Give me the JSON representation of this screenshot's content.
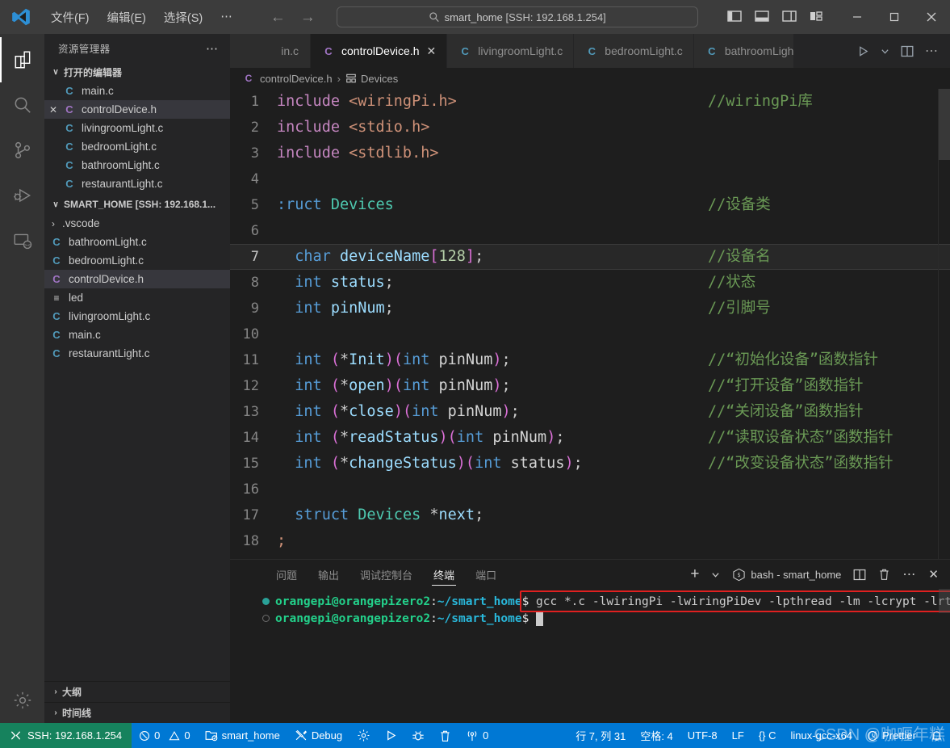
{
  "titlebar": {
    "logo": "vscode-logo",
    "menus": [
      "文件(F)",
      "编辑(E)",
      "选择(S)",
      "⋯"
    ],
    "nav_back": "←",
    "nav_forward": "→",
    "command_center": {
      "icon": "search-icon",
      "project": "smart_home ",
      "ssh": "[SSH: 192.168.1.254]"
    },
    "layout_icons": [
      "toggle-primary-sidebar-icon",
      "toggle-panel-icon",
      "toggle-secondary-sidebar-icon",
      "customize-layout-icon"
    ],
    "window_controls": {
      "minimize": "–",
      "maximize": "□",
      "close": "✕"
    }
  },
  "activitybar": {
    "items": [
      {
        "name": "explorer",
        "icon": "files-icon",
        "active": true
      },
      {
        "name": "search",
        "icon": "search-icon",
        "active": false
      },
      {
        "name": "source-control",
        "icon": "source-control-icon",
        "active": false
      },
      {
        "name": "run-debug",
        "icon": "run-and-debug-icon",
        "active": false
      },
      {
        "name": "remote-explorer",
        "icon": "remote-explorer-icon",
        "active": false
      }
    ],
    "manage": {
      "name": "settings",
      "icon": "gear-icon"
    }
  },
  "sidebar": {
    "title": "资源管理器",
    "more": "⋯",
    "open_editors": {
      "label": "打开的编辑器",
      "chevron": "∨",
      "items": [
        {
          "name": "main.c",
          "icon": "c-file-icon",
          "selected": false,
          "closable": false
        },
        {
          "name": "controlDevice.h",
          "icon": "h-file-icon",
          "selected": true,
          "closable": true
        },
        {
          "name": "livingroomLight.c",
          "icon": "c-file-icon",
          "selected": false,
          "closable": false
        },
        {
          "name": "bedroomLight.c",
          "icon": "c-file-icon",
          "selected": false,
          "closable": false
        },
        {
          "name": "bathroomLight.c",
          "icon": "c-file-icon",
          "selected": false,
          "closable": false
        },
        {
          "name": "restaurantLight.c",
          "icon": "c-file-icon",
          "selected": false,
          "closable": false
        }
      ]
    },
    "workspace": {
      "label": "SMART_HOME [SSH: 192.168.1...",
      "chevron": "∨",
      "items": [
        {
          "name": ".vscode",
          "icon": "folder-chevron",
          "kind": "folder",
          "selected": false
        },
        {
          "name": "bathroomLight.c",
          "icon": "c-file-icon",
          "kind": "c",
          "selected": false
        },
        {
          "name": "bedroomLight.c",
          "icon": "c-file-icon",
          "kind": "c",
          "selected": false
        },
        {
          "name": "controlDevice.h",
          "icon": "h-file-icon",
          "kind": "h",
          "selected": true
        },
        {
          "name": "led",
          "icon": "binary-file-icon",
          "kind": "bin",
          "selected": false
        },
        {
          "name": "livingroomLight.c",
          "icon": "c-file-icon",
          "kind": "c",
          "selected": false
        },
        {
          "name": "main.c",
          "icon": "c-file-icon",
          "kind": "c",
          "selected": false
        },
        {
          "name": "restaurantLight.c",
          "icon": "c-file-icon",
          "kind": "c",
          "selected": false
        }
      ]
    },
    "bottom_sections": [
      {
        "label": "大纲",
        "chevron": "›"
      },
      {
        "label": "时间线",
        "chevron": "›"
      }
    ]
  },
  "tabs": {
    "items": [
      {
        "label": "in.c",
        "icon": "c-file-icon",
        "active": false,
        "closable": false,
        "clipped": true
      },
      {
        "label": "controlDevice.h",
        "icon": "h-file-icon",
        "active": true,
        "closable": true
      },
      {
        "label": "livingroomLight.c",
        "icon": "c-file-icon",
        "active": false,
        "closable": false
      },
      {
        "label": "bedroomLight.c",
        "icon": "c-file-icon",
        "active": false,
        "closable": false
      },
      {
        "label": "bathroomLigh",
        "icon": "c-file-icon",
        "active": false,
        "closable": false,
        "clipped": true
      }
    ],
    "actions": [
      "run-icon",
      "chevron-down-icon",
      "split-editor-icon",
      "more-actions-icon"
    ]
  },
  "breadcrumb": {
    "file": "controlDevice.h",
    "separator": "›",
    "symbol": "Devices"
  },
  "editor": {
    "current_line": 7,
    "lines": [
      {
        "n": 1,
        "tokens": [
          {
            "t": "pre",
            "v": "include"
          },
          {
            "t": "plain",
            "v": " "
          },
          {
            "t": "str",
            "v": "<wiringPi.h>"
          }
        ],
        "comment": "//wiringPi库"
      },
      {
        "n": 2,
        "tokens": [
          {
            "t": "pre",
            "v": "include"
          },
          {
            "t": "plain",
            "v": " "
          },
          {
            "t": "str",
            "v": "<stdio.h>"
          }
        ],
        "comment": ""
      },
      {
        "n": 3,
        "tokens": [
          {
            "t": "pre",
            "v": "include"
          },
          {
            "t": "plain",
            "v": " "
          },
          {
            "t": "str",
            "v": "<stdlib.h>"
          }
        ],
        "comment": ""
      },
      {
        "n": 4,
        "tokens": [],
        "comment": ""
      },
      {
        "n": 5,
        "tokens": [
          {
            "t": "kw",
            "v": ":ruct"
          },
          {
            "t": "plain",
            "v": " "
          },
          {
            "t": "type",
            "v": "Devices"
          }
        ],
        "comment": "//设备类"
      },
      {
        "n": 6,
        "tokens": [],
        "comment": ""
      },
      {
        "n": 7,
        "tokens": [
          {
            "t": "plain",
            "v": "  "
          },
          {
            "t": "kw",
            "v": "char"
          },
          {
            "t": "plain",
            "v": " "
          },
          {
            "t": "var",
            "v": "deviceName"
          },
          {
            "t": "brk",
            "v": "["
          },
          {
            "t": "num",
            "v": "128"
          },
          {
            "t": "brk",
            "v": "]"
          },
          {
            "t": "punc",
            "v": ";"
          }
        ],
        "comment": "//设备名"
      },
      {
        "n": 8,
        "tokens": [
          {
            "t": "plain",
            "v": "  "
          },
          {
            "t": "kw",
            "v": "int"
          },
          {
            "t": "plain",
            "v": " "
          },
          {
            "t": "var",
            "v": "status"
          },
          {
            "t": "punc",
            "v": ";"
          }
        ],
        "comment": "//状态"
      },
      {
        "n": 9,
        "tokens": [
          {
            "t": "plain",
            "v": "  "
          },
          {
            "t": "kw",
            "v": "int"
          },
          {
            "t": "plain",
            "v": " "
          },
          {
            "t": "var",
            "v": "pinNum"
          },
          {
            "t": "punc",
            "v": ";"
          }
        ],
        "comment": "//引脚号"
      },
      {
        "n": 10,
        "tokens": [],
        "comment": ""
      },
      {
        "n": 11,
        "tokens": [
          {
            "t": "plain",
            "v": "  "
          },
          {
            "t": "kw",
            "v": "int"
          },
          {
            "t": "plain",
            "v": " "
          },
          {
            "t": "brk",
            "v": "("
          },
          {
            "t": "punc",
            "v": "*"
          },
          {
            "t": "var",
            "v": "Init"
          },
          {
            "t": "brk",
            "v": ")"
          },
          {
            "t": "brk",
            "v": "("
          },
          {
            "t": "kw",
            "v": "int"
          },
          {
            "t": "plain",
            "v": " "
          },
          {
            "t": "plain",
            "v": "pinNum"
          },
          {
            "t": "brk",
            "v": ")"
          },
          {
            "t": "punc",
            "v": ";"
          }
        ],
        "comment": "//“初始化设备”函数指针"
      },
      {
        "n": 12,
        "tokens": [
          {
            "t": "plain",
            "v": "  "
          },
          {
            "t": "kw",
            "v": "int"
          },
          {
            "t": "plain",
            "v": " "
          },
          {
            "t": "brk",
            "v": "("
          },
          {
            "t": "punc",
            "v": "*"
          },
          {
            "t": "var",
            "v": "open"
          },
          {
            "t": "brk",
            "v": ")"
          },
          {
            "t": "brk",
            "v": "("
          },
          {
            "t": "kw",
            "v": "int"
          },
          {
            "t": "plain",
            "v": " "
          },
          {
            "t": "plain",
            "v": "pinNum"
          },
          {
            "t": "brk",
            "v": ")"
          },
          {
            "t": "punc",
            "v": ";"
          }
        ],
        "comment": "//“打开设备”函数指针"
      },
      {
        "n": 13,
        "tokens": [
          {
            "t": "plain",
            "v": "  "
          },
          {
            "t": "kw",
            "v": "int"
          },
          {
            "t": "plain",
            "v": " "
          },
          {
            "t": "brk",
            "v": "("
          },
          {
            "t": "punc",
            "v": "*"
          },
          {
            "t": "var",
            "v": "close"
          },
          {
            "t": "brk",
            "v": ")"
          },
          {
            "t": "brk",
            "v": "("
          },
          {
            "t": "kw",
            "v": "int"
          },
          {
            "t": "plain",
            "v": " "
          },
          {
            "t": "plain",
            "v": "pinNum"
          },
          {
            "t": "brk",
            "v": ")"
          },
          {
            "t": "punc",
            "v": ";"
          }
        ],
        "comment": "//“关闭设备”函数指针"
      },
      {
        "n": 14,
        "tokens": [
          {
            "t": "plain",
            "v": "  "
          },
          {
            "t": "kw",
            "v": "int"
          },
          {
            "t": "plain",
            "v": " "
          },
          {
            "t": "brk",
            "v": "("
          },
          {
            "t": "punc",
            "v": "*"
          },
          {
            "t": "var",
            "v": "readStatus"
          },
          {
            "t": "brk",
            "v": ")"
          },
          {
            "t": "brk",
            "v": "("
          },
          {
            "t": "kw",
            "v": "int"
          },
          {
            "t": "plain",
            "v": " "
          },
          {
            "t": "plain",
            "v": "pinNum"
          },
          {
            "t": "brk",
            "v": ")"
          },
          {
            "t": "punc",
            "v": ";"
          }
        ],
        "comment": "//“读取设备状态”函数指针"
      },
      {
        "n": 15,
        "tokens": [
          {
            "t": "plain",
            "v": "  "
          },
          {
            "t": "kw",
            "v": "int"
          },
          {
            "t": "plain",
            "v": " "
          },
          {
            "t": "brk",
            "v": "("
          },
          {
            "t": "punc",
            "v": "*"
          },
          {
            "t": "var",
            "v": "changeStatus"
          },
          {
            "t": "brk",
            "v": ")"
          },
          {
            "t": "brk",
            "v": "("
          },
          {
            "t": "kw",
            "v": "int"
          },
          {
            "t": "plain",
            "v": " "
          },
          {
            "t": "plain",
            "v": "status"
          },
          {
            "t": "brk",
            "v": ")"
          },
          {
            "t": "punc",
            "v": ";"
          }
        ],
        "comment": "//“改变设备状态”函数指针"
      },
      {
        "n": 16,
        "tokens": [],
        "comment": ""
      },
      {
        "n": 17,
        "tokens": [
          {
            "t": "plain",
            "v": "  "
          },
          {
            "t": "kw",
            "v": "struct"
          },
          {
            "t": "plain",
            "v": " "
          },
          {
            "t": "type",
            "v": "Devices"
          },
          {
            "t": "plain",
            "v": " "
          },
          {
            "t": "punc",
            "v": "*"
          },
          {
            "t": "var",
            "v": "next"
          },
          {
            "t": "punc",
            "v": ";"
          }
        ],
        "comment": ""
      },
      {
        "n": 18,
        "tokens": [
          {
            "t": "str",
            "v": ";"
          }
        ],
        "comment": ""
      }
    ]
  },
  "panel": {
    "tabs": [
      {
        "label": "问题",
        "active": false
      },
      {
        "label": "输出",
        "active": false
      },
      {
        "label": "调试控制台",
        "active": false
      },
      {
        "label": "终端",
        "active": true
      },
      {
        "label": "端口",
        "active": false
      }
    ],
    "actions": {
      "new_terminal": "+",
      "dropdown": "∨",
      "shell_icon": "terminal-bash-icon",
      "shell_name": "bash - smart_home",
      "split": "split-terminal-icon",
      "kill": "trash-icon",
      "more": "⋯",
      "close": "✕"
    },
    "terminal_lines": [
      {
        "status": "on",
        "user": "orangepi@orangepizero2",
        "colon": ":",
        "path": "~/smart_home",
        "dollar": "$ ",
        "command": "gcc *.c -lwiringPi -lwiringPiDev -lpthread -lm -lcrypt -lrt -o led",
        "highlighted": true,
        "cursor": false
      },
      {
        "status": "off",
        "user": "orangepi@orangepizero2",
        "colon": ":",
        "path": "~/smart_home",
        "dollar": "$ ",
        "command": "",
        "highlighted": false,
        "cursor": true
      }
    ],
    "annotation_color": "#e02020"
  },
  "statusbar": {
    "remote": {
      "icon": "remote-icon",
      "label": "SSH: 192.168.1.254",
      "color": "#16825d"
    },
    "background": "#0078d4",
    "items": [
      {
        "name": "problems",
        "icon": "error-warning-icon",
        "errors": "0",
        "warnings": "0"
      },
      {
        "name": "workspace",
        "icon": "folder-config-icon",
        "label": "smart_home"
      },
      {
        "name": "debug-config",
        "icon": "tools-icon",
        "label": "Debug"
      },
      {
        "name": "settings-gear",
        "icon": "gear-icon",
        "label": ""
      },
      {
        "name": "run-build",
        "icon": "play-icon",
        "label": ""
      },
      {
        "name": "debug-build",
        "icon": "bug-icon",
        "label": ""
      },
      {
        "name": "clean-build",
        "icon": "trash-icon",
        "label": ""
      },
      {
        "name": "live-share",
        "icon": "broadcast-icon",
        "label": "0"
      }
    ],
    "right_items": [
      {
        "name": "cursor-position",
        "label": "行 7, 列 31"
      },
      {
        "name": "indentation",
        "label": "空格: 4"
      },
      {
        "name": "encoding",
        "label": "UTF-8"
      },
      {
        "name": "eol",
        "label": "LF"
      },
      {
        "name": "language-mode",
        "label": "{} C"
      },
      {
        "name": "cpp-config",
        "label": "linux-gcc-x64"
      },
      {
        "name": "prettier",
        "label": "Prettier"
      },
      {
        "name": "notifications",
        "label": ""
      }
    ],
    "watermark": "CSDN @咖喱年糕"
  }
}
